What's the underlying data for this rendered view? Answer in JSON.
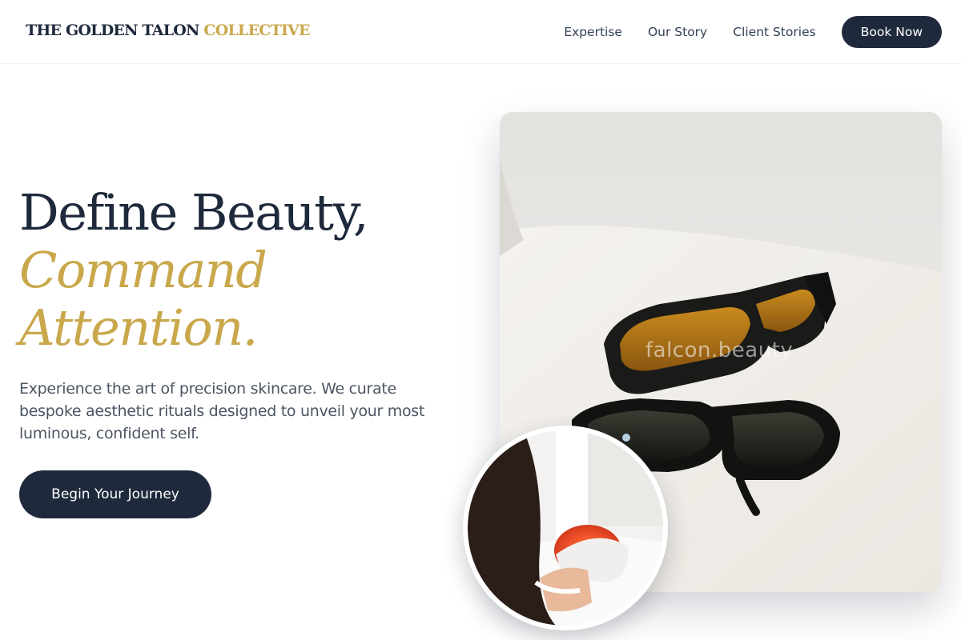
{
  "brand": {
    "name_main": "THE GOLDEN TALON",
    "name_accent": "COLLECTIVE",
    "accent_color": "#c9a84c",
    "primary_color": "#1e293b"
  },
  "nav": {
    "links": [
      "Expertise",
      "Our Story",
      "Client Stories"
    ],
    "cta_label": "Book Now"
  },
  "hero": {
    "headline_line1": "Define Beauty,",
    "headline_line2": "Command",
    "headline_line3": "Attention.",
    "subtext": "Experience the art of precision skincare. We curate bespoke aesthetic rituals designed to unveil your most luminous, confident self.",
    "cta_label": "Begin Your Journey"
  },
  "images": {
    "main_watermark": "falcon.beauty",
    "main_subject": "protective-eyewear-photo",
    "inset_subject": "led-light-therapy-photo"
  }
}
